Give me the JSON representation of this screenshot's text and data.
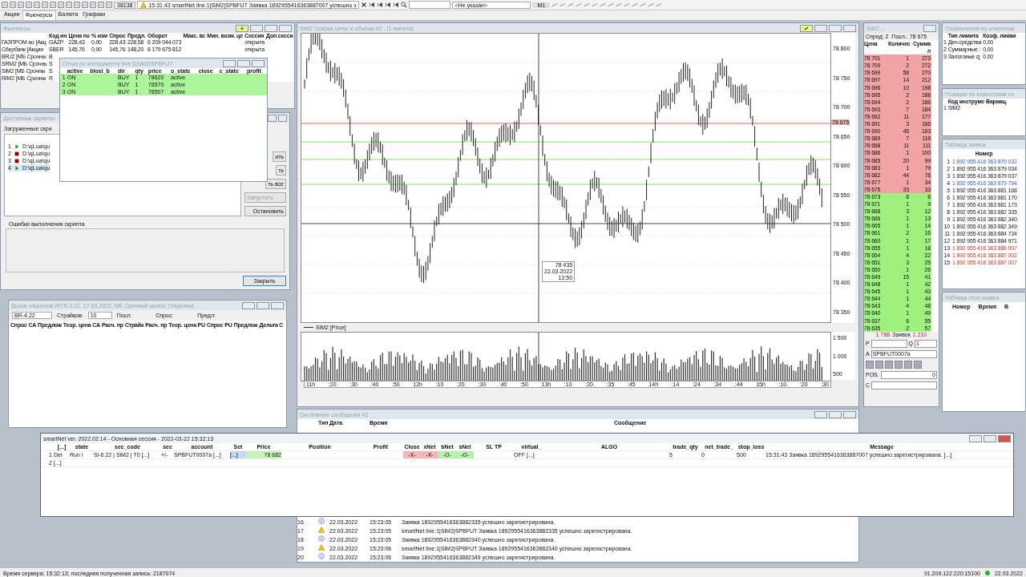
{
  "toolbar": {
    "counter": "38138",
    "notice": "15:31:43  smartNet line:1|SiM2|SPBFUT Заявка 1892955416363887007 успешно з",
    "instrument": "<Не указан>",
    "timeframe": "M1"
  },
  "menu_tabs": [
    {
      "label": "Акции",
      "selected": false
    },
    {
      "label": "Фьючерсы",
      "selected": true
    },
    {
      "label": "Валюта",
      "selected": false
    },
    {
      "label": "Графики",
      "selected": false
    }
  ],
  "futures": {
    "title": "Фьючерсы",
    "columns": [
      "",
      "Код ин",
      "Цена по",
      "% изм",
      "Спрос",
      "Предл.",
      "Оборот",
      "Макс. вс",
      "Мин. возм. це",
      "Сессия",
      "Доп.сесси"
    ],
    "rows": [
      [
        "ГАЗПРОМ ао [Акц",
        "GAZP",
        "228,43",
        "0,00",
        "228,43",
        "228,58",
        "6 209 044 073",
        "",
        "",
        "открыта",
        ""
      ],
      [
        "Сбербанк [Акции",
        "SBER",
        "145,76",
        "0,00",
        "145,76",
        "148,20",
        "8 179 675 812",
        "",
        "",
        "открыта",
        ""
      ],
      [
        "BRJ2 [МБ Срочны",
        "B",
        "",
        "",
        "",
        "",
        "",
        "",
        "",
        "",
        ""
      ],
      [
        "SRM2 [МБ Срочнь",
        "S",
        "",
        "",
        "",
        "",
        "",
        "",
        "",
        "",
        ""
      ],
      [
        "SiM2 [МБ Срочны",
        "S",
        "",
        "",
        "",
        "",
        "",
        "",
        "",
        "",
        ""
      ],
      [
        "RIM2 [МБ Срочны",
        "R",
        "",
        "",
        "",
        "",
        "",
        "",
        "",
        "",
        ""
      ]
    ]
  },
  "grid": {
    "title": "Сетка по инструменту line:1|SiM2|SPBFUT",
    "columns": [
      "active",
      "blosl_b",
      "dir",
      "qty",
      "price",
      "o_state",
      "close",
      "c_state",
      "profit"
    ],
    "rows": [
      {
        "n": "1",
        "cells": [
          "ON",
          "",
          "BUY",
          "1",
          "78620",
          "active",
          "",
          "",
          ""
        ],
        "active": true
      },
      {
        "n": "2",
        "cells": [
          "ON",
          "",
          "BUY",
          "1",
          "78570",
          "active",
          "",
          "",
          ""
        ],
        "active": true
      },
      {
        "n": "3",
        "cells": [
          "ON",
          "",
          "BUY",
          "1",
          "78507",
          "active",
          "",
          "",
          ""
        ],
        "active": true
      }
    ]
  },
  "scripts": {
    "title": "Доступные скрипты",
    "loaded_label": "Загруженные скри",
    "items": [
      {
        "n": "1",
        "path": "D:\\qLua\\qu",
        "running": true,
        "selected": false
      },
      {
        "n": "2",
        "path": "D:\\qLua\\qu",
        "running": false,
        "selected": false
      },
      {
        "n": "3",
        "path": "D:\\qLua\\qu",
        "running": false,
        "selected": false
      },
      {
        "n": "4",
        "path": "D:\\qLua\\qu",
        "running": true,
        "selected": true
      }
    ],
    "buttons": [
      {
        "label": "ить",
        "disabled": false
      },
      {
        "label": "ть",
        "disabled": false
      },
      {
        "label": "ть все",
        "disabled": false
      },
      {
        "label": "Запустить",
        "disabled": true
      },
      {
        "label": "Остановить",
        "disabled": false
      }
    ],
    "errors_label": "Ошибки выполнения скрипта",
    "close_button": "Закрыть"
  },
  "options": {
    "title": "Доска опционов [RTS-3.22, 17.03.2022, МБ Срочный рынок: Опционы]",
    "series": "BR-4.22",
    "strikes_label": "Страйков:",
    "strikes": "10",
    "last_label": "Посл:",
    "bid_label": "Спрос:",
    "ask_label": "Предл:",
    "columns": [
      "Спрос CA",
      "Предлож",
      "Теор. цена CA",
      "Расч. пр",
      "Страйк",
      "Расч. пр",
      "Теор. цена PU",
      "Спрос PU",
      "Предлож",
      "Дельта С"
    ]
  },
  "chart": {
    "title": "SiM2 График цены и объёма #2 - [1 минута]",
    "yticks": [
      "78 800",
      "78 750",
      "78 700",
      "78 650",
      "78 600",
      "78 550",
      "78 500",
      "78 450",
      "78 400",
      "78 350"
    ],
    "last_price": "78 675",
    "cursor_label": [
      "78 435",
      "22.03.2022",
      "12:50"
    ],
    "legend": "SiM2 [Price]",
    "volume_ticks": [
      "1 500",
      "1 000",
      "500"
    ],
    "xlabels": [
      "11h",
      ":20",
      ":30",
      ":40",
      ":50",
      "12h",
      ":10",
      ":20",
      ":30",
      ":40",
      ":50",
      "13h",
      ":10",
      ":20",
      ":35",
      ":45",
      "14h",
      ":14",
      ":24",
      ":34",
      ":44",
      "15h",
      ":10",
      ":20",
      ":30"
    ]
  },
  "orderbook": {
    "title": "SiM2 ...",
    "spread": "Спред: 2",
    "last": "Посл.: 78 675",
    "columns": [
      "Цена",
      "Количес",
      "Сумма л"
    ],
    "asks": [
      [
        "78 701",
        "1",
        "273"
      ],
      [
        "78 700",
        "2",
        "272"
      ],
      [
        "78 699",
        "58",
        "270"
      ],
      [
        "78 697",
        "14",
        "212"
      ],
      [
        "78 696",
        "10",
        "198"
      ],
      [
        "78 695",
        "2",
        "188"
      ],
      [
        "78 694",
        "2",
        "186"
      ],
      [
        "78 693",
        "7",
        "184"
      ],
      [
        "78 692",
        "11",
        "177"
      ],
      [
        "78 691",
        "3",
        "166"
      ],
      [
        "78 690",
        "45",
        "163"
      ],
      [
        "78 689",
        "7",
        "118"
      ],
      [
        "78 688",
        "11",
        "111"
      ],
      [
        "78 686",
        "1",
        "100"
      ],
      [
        "78 685",
        "20",
        "99"
      ],
      [
        "78 683",
        "1",
        "79"
      ],
      [
        "78 682",
        "44",
        "78"
      ],
      [
        "78 677",
        "1",
        "34"
      ],
      [
        "78 675",
        "33",
        "33"
      ]
    ],
    "bids": [
      [
        "78 673",
        "8",
        "8"
      ],
      [
        "78 671",
        "1",
        "9"
      ],
      [
        "78 668",
        "3",
        "12"
      ],
      [
        "78 666",
        "1",
        "13"
      ],
      [
        "78 665",
        "1",
        "14"
      ],
      [
        "78 661",
        "2",
        "16"
      ],
      [
        "78 660",
        "1",
        "17"
      ],
      [
        "78 655",
        "1",
        "18"
      ],
      [
        "78 654",
        "4",
        "22"
      ],
      [
        "78 651",
        "3",
        "25"
      ],
      [
        "78 650",
        "1",
        "26"
      ],
      [
        "78 649",
        "15",
        "41"
      ],
      [
        "78 648",
        "1",
        "42"
      ],
      [
        "78 645",
        "1",
        "43"
      ],
      [
        "78 644",
        "1",
        "44"
      ],
      [
        "78 643",
        "4",
        "48"
      ],
      [
        "78 640",
        "1",
        "49"
      ],
      [
        "78 637",
        "6",
        "55"
      ],
      [
        "78 635",
        "2",
        "57"
      ]
    ],
    "footer": [
      "1 788",
      "Заявок",
      "1 210"
    ],
    "p_label": "P",
    "q_label": "Q",
    "q_value": "1",
    "a_label": "A",
    "account": "SPBFUT0007a",
    "pos_label": "POS.",
    "pos_value": "0",
    "c_label": "C"
  },
  "limits": {
    "title": "Ограничения по клиентски",
    "columns": [
      "",
      "Тип лимита",
      "Коэф. ликви"
    ],
    "rows": [
      [
        "1",
        "Ден.средства",
        "0,00"
      ],
      [
        "2",
        "Суммарные :",
        "0,00"
      ],
      [
        "3",
        "Залоговые сј",
        "0,00"
      ]
    ]
  },
  "positions": {
    "title": "Позиции по клиентским сч",
    "columns": [
      "",
      "Код инструме",
      "Вариац."
    ],
    "rows": [
      [
        "1",
        "SiM2",
        ""
      ]
    ]
  },
  "orders": {
    "title": "Таблица заявок",
    "column": "Номер",
    "rows": [
      {
        "n": "1",
        "number": "1 892 955 416 363 879 032",
        "kind": "active"
      },
      {
        "n": "2",
        "number": "1 892 955 416 363 879 034",
        "kind": "executed"
      },
      {
        "n": "3",
        "number": "1 892 955 416 363 879 037",
        "kind": "executed"
      },
      {
        "n": "4",
        "number": "1 892 955 416 363 879 794",
        "kind": "active"
      },
      {
        "n": "5",
        "number": "1 892 955 416 363 881 168",
        "kind": "executed"
      },
      {
        "n": "6",
        "number": "1 892 955 416 363 881 170",
        "kind": "executed"
      },
      {
        "n": "7",
        "number": "1 892 955 416 363 881 173",
        "kind": "executed"
      },
      {
        "n": "8",
        "number": "1 892 955 416 363 882 335",
        "kind": "executed"
      },
      {
        "n": "9",
        "number": "1 892 955 416 363 882 340",
        "kind": "executed"
      },
      {
        "n": "10",
        "number": "1 892 955 416 363 882 349",
        "kind": "executed"
      },
      {
        "n": "11",
        "number": "1 892 955 416 363 884 734",
        "kind": "executed"
      },
      {
        "n": "12",
        "number": "1 892 955 416 363 884 971",
        "kind": "executed"
      },
      {
        "n": "13",
        "number": "1 892 955 416 363 886 997",
        "kind": "cancelled"
      },
      {
        "n": "14",
        "number": "1 892 955 416 363 887 002",
        "kind": "cancelled"
      },
      {
        "n": "15",
        "number": "1 892 955 416 363 887 007",
        "kind": "cancelled"
      }
    ]
  },
  "stop_orders": {
    "title": "Таблица стоп-заявок",
    "columns": [
      "Номер",
      "Время",
      "В"
    ]
  },
  "messages": {
    "title": "Системные сообщения #2",
    "columns": [
      "Тип",
      "Дата",
      "Время",
      "Сообщение"
    ],
    "rows": [
      {
        "n": "16",
        "kind": "info",
        "date": "22.03.2022",
        "time": "15:23:05",
        "text": "Заявка 1892955416363882335 успешно зарегистрирована."
      },
      {
        "n": "17",
        "kind": "warning",
        "date": "22.03.2022",
        "time": "15:23:05",
        "text": "smartNet line:1|SiM2|SPBFUT Заявка 1892955416363882335 успешно зарегистрирована."
      },
      {
        "n": "18",
        "kind": "info",
        "date": "22.03.2022",
        "time": "15:23:05",
        "text": "Заявка 1892955416363882340 успешно зарегистрирована."
      },
      {
        "n": "19",
        "kind": "warning",
        "date": "22.03.2022",
        "time": "15:23:06",
        "text": "smartNet line:1|SiM2|SPBFUT Заявка 1892955416363882340 успешно зарегистрирована."
      },
      {
        "n": "20",
        "kind": "info",
        "date": "22.03.2022",
        "time": "15:23:06",
        "text": "Заявка 1892955416363882349 успешно зарегистрирована."
      }
    ]
  },
  "smartnet": {
    "title": "smartNet ver. 2022.02.14  -  Основная сессия  -  2022-03-22 15:32:13",
    "columns": [
      "[...]",
      "state",
      "sec_code",
      "sec",
      "account",
      "Set",
      "Price",
      "Position",
      "Profit",
      "Close",
      "xNet",
      "bNet",
      "sNet",
      "SL TP",
      "virtual_",
      "ALGO",
      "trade_qty",
      "net_trade_",
      "stop_loss",
      "Message"
    ],
    "rows": [
      {
        "n": "1",
        "cells": [
          "Del",
          "Run \\",
          "Si-6.22 | SiM2 | T0 [...]",
          "+/-",
          "SPBFUT0007a [...]",
          "[...]",
          "78 682",
          "",
          "",
          "-X-",
          "-X-",
          "-O-",
          "-O-",
          "",
          "OFF [...]",
          "",
          "5",
          "0",
          "500",
          "15:31:43 Заявка 1892955416363887007 успешно зарегистрирована. [...]"
        ]
      },
      {
        "n": "2",
        "cells": [
          "[...]"
        ]
      }
    ]
  },
  "status_bar": {
    "server": "Время сервера: 15:32:13; последняя полученная запись: 2187074",
    "address": "91.209.122.220:15100",
    "date": "22.03.2022"
  }
}
